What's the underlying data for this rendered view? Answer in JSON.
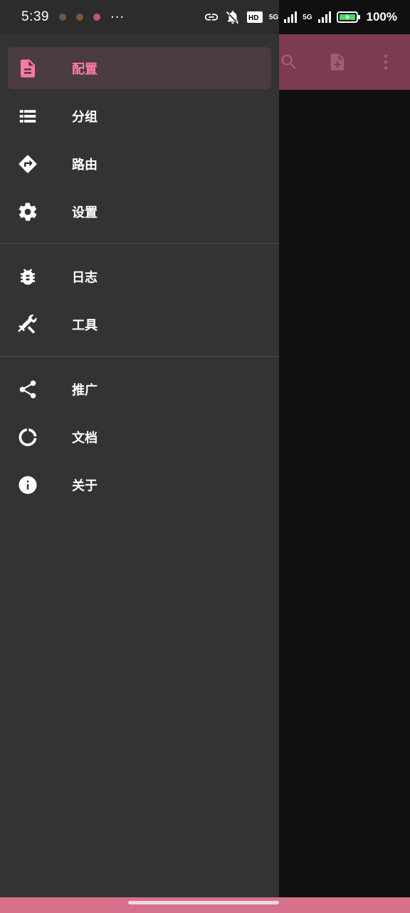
{
  "status_bar": {
    "time": "5:39",
    "more": "···",
    "net_1": "5G",
    "net_2": "5G",
    "battery": "100%"
  },
  "toolbar": {
    "actions": [
      "search-icon",
      "add-file-icon",
      "more-vert-icon"
    ]
  },
  "drawer": {
    "group_main": [
      {
        "label": "配置",
        "icon": "file-document-icon",
        "selected": true
      },
      {
        "label": "分组",
        "icon": "list-icon",
        "selected": false
      },
      {
        "label": "路由",
        "icon": "route-sign-icon",
        "selected": false
      },
      {
        "label": "设置",
        "icon": "gear-icon",
        "selected": false
      }
    ],
    "group_tools": [
      {
        "label": "日志",
        "icon": "bug-icon"
      },
      {
        "label": "工具",
        "icon": "tools-icon"
      }
    ],
    "group_info": [
      {
        "label": "推广",
        "icon": "share-icon"
      },
      {
        "label": "文档",
        "icon": "circle-progress-icon"
      },
      {
        "label": "关于",
        "icon": "info-icon"
      }
    ]
  },
  "colors": {
    "accent": "#ff7aa2",
    "toolbar": "#7c3b4f",
    "drawer_bg": "#333333",
    "nav_bar": "#d6718c"
  }
}
